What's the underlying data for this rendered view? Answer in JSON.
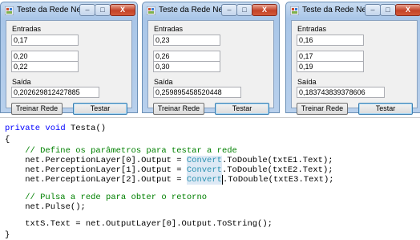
{
  "windows": [
    {
      "title": "Teste da Rede Neural",
      "entradas_label": "Entradas",
      "inputs": [
        "0,17",
        "0,20",
        "0,22"
      ],
      "saida_label": "Saída",
      "output": "0,202629812427885",
      "treinar_label": "Treinar Rede",
      "testar_label": "Testar"
    },
    {
      "title": "Teste da Rede Neural",
      "entradas_label": "Entradas",
      "inputs": [
        "0,23",
        "0,26",
        "0,30"
      ],
      "saida_label": "Saída",
      "output": "0,259895458520448",
      "treinar_label": "Treinar Rede",
      "testar_label": "Testar"
    },
    {
      "title": "Teste da Rede Neural",
      "entradas_label": "Entradas",
      "inputs": [
        "0,16",
        "0,17",
        "0,19"
      ],
      "saida_label": "Saída",
      "output": "0,183743839378606",
      "treinar_label": "Treinar Rede",
      "testar_label": "Testar"
    }
  ],
  "window_controls": {
    "minimize": "–",
    "maximize": "□",
    "close": "X"
  },
  "code": {
    "l1_kw1": "private",
    "l1_kw2": "void",
    "l1_rest": " Testa()",
    "l2": "{",
    "l3": "    // Define os parâmetros para testar a rede",
    "l4_pre": "    net.PerceptionLayer[0].Output = ",
    "l5_pre": "    net.PerceptionLayer[1].Output = ",
    "l6_pre": "    net.PerceptionLayer[2].Output = ",
    "convert": "Convert",
    "l4_post": ".ToDouble(txtE1.Text);",
    "l5_post": ".ToDouble(txtE2.Text);",
    "l6_post": ".ToDouble(txtE3.Text);",
    "l7": "    // Pulsa a rede para obter o retorno",
    "l8": "    net.Pulse();",
    "l9": "    txtS.Text = net.OutputLayer[0].Output.ToString();",
    "l10": "}"
  },
  "colors": {
    "keyword": "#0000ff",
    "comment": "#008000",
    "type": "#2b91af"
  }
}
